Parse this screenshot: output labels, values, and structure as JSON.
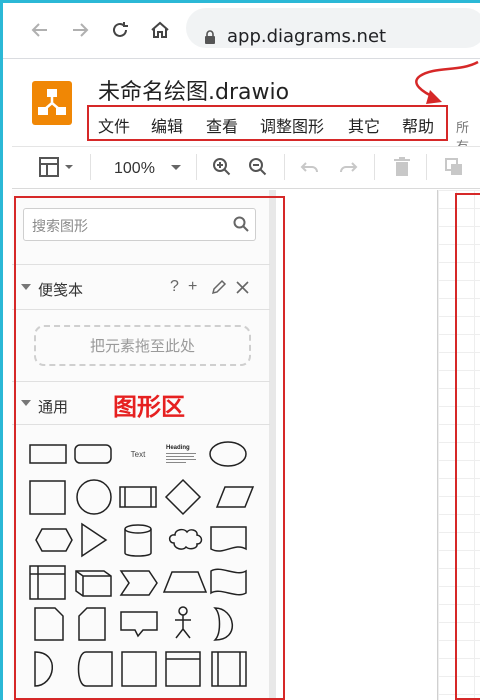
{
  "browser": {
    "url": "app.diagrams.net"
  },
  "app": {
    "title": "未命名绘图.drawio",
    "menu": [
      {
        "label": "文件"
      },
      {
        "label": "编辑"
      },
      {
        "label": "查看"
      },
      {
        "label": "调整图形"
      },
      {
        "label": "其它"
      },
      {
        "label": "帮助"
      }
    ],
    "menu_overflow": "所有"
  },
  "toolbar": {
    "zoom": "100%"
  },
  "sidebar": {
    "search_placeholder": "搜索图形",
    "scratchpad": {
      "title": "便笺本",
      "help": "?",
      "add": "+",
      "drop_hint": "把元素拖至此处"
    },
    "general": {
      "title": "通用",
      "shape_text_label": "Text",
      "shape_heading_label": "Heading"
    }
  },
  "annotation": {
    "shapes_area_label": "图形区",
    "color": "#d62828"
  },
  "colors": {
    "logo": "#f08705",
    "frame": "#2bb8d6"
  }
}
